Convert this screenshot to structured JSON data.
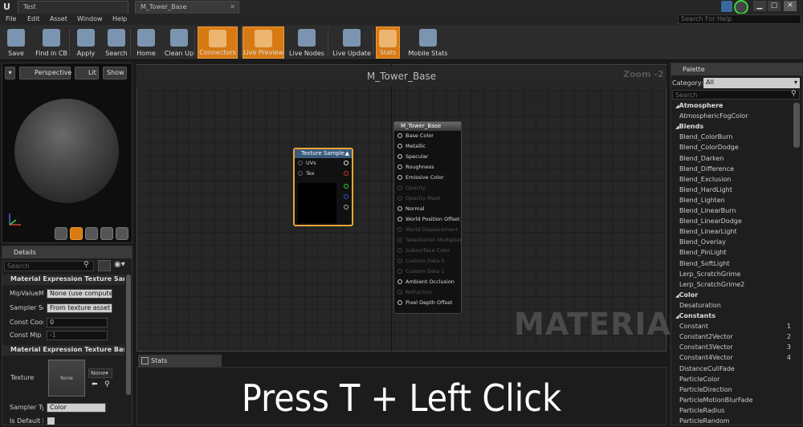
{
  "window": {
    "tabs": [
      "Test",
      "M_Tower_Base"
    ],
    "help_search_placeholder": "Search For Help"
  },
  "menu": [
    "File",
    "Edit",
    "Asset",
    "Window",
    "Help"
  ],
  "toolbar": [
    {
      "label": "Save",
      "icon": "save-icon",
      "active": false
    },
    {
      "label": "Find in CB",
      "icon": "find-icon",
      "active": false
    },
    {
      "label": "Apply",
      "icon": "apply-icon",
      "active": false
    },
    {
      "label": "Search",
      "icon": "binoculars-icon",
      "active": false
    },
    {
      "label": "Home",
      "icon": "home-icon",
      "active": false
    },
    {
      "label": "Clean Up",
      "icon": "broom-icon",
      "active": false
    },
    {
      "label": "Connectors",
      "icon": "connectors-icon",
      "active": true
    },
    {
      "label": "Live Preview",
      "icon": "live-preview-icon",
      "active": true
    },
    {
      "label": "Live Nodes",
      "icon": "live-nodes-icon",
      "active": false
    },
    {
      "label": "Live Update",
      "icon": "live-update-icon",
      "active": false
    },
    {
      "label": "Stats",
      "icon": "stats-icon",
      "active": true
    },
    {
      "label": "Mobile Stats",
      "icon": "mobile-stats-icon",
      "active": false
    }
  ],
  "viewport": {
    "buttons": [
      "Perspective",
      "Lit",
      "Show"
    ]
  },
  "details": {
    "tab": "Details",
    "search_placeholder": "Search",
    "section1": "Material Expression Texture Sample",
    "section2": "Material Expression Texture Base",
    "props": [
      {
        "label": "MipValueMode",
        "value": "None (use computed mip level)"
      },
      {
        "label": "Sampler Source",
        "value": "From texture asset"
      },
      {
        "label": "Const Coordinate",
        "value": "0"
      },
      {
        "label": "Const Mip Value",
        "value": "-1"
      }
    ],
    "texture_label": "Texture",
    "texture_value": "None",
    "texture_combo": "None",
    "sampler_type_label": "Sampler Type",
    "sampler_type_value": "Color",
    "is_default_label": "Is Default Meshpaint Texture"
  },
  "graph": {
    "title": "M_Tower_Base",
    "zoom": "Zoom -2",
    "watermark": "MATERIAL",
    "texture_node": {
      "title": "Texture Sample",
      "inputs": [
        "UVs",
        "Tex"
      ]
    },
    "material_node": {
      "title": "M_Tower_Base",
      "pins": [
        {
          "label": "Base Color",
          "enabled": true
        },
        {
          "label": "Metallic",
          "enabled": true
        },
        {
          "label": "Specular",
          "enabled": true
        },
        {
          "label": "Roughness",
          "enabled": true
        },
        {
          "label": "Emissive Color",
          "enabled": true
        },
        {
          "label": "Opacity",
          "enabled": false
        },
        {
          "label": "Opacity Mask",
          "enabled": false
        },
        {
          "label": "Normal",
          "enabled": true
        },
        {
          "label": "World Position Offset",
          "enabled": true
        },
        {
          "label": "World Displacement",
          "enabled": false
        },
        {
          "label": "Tessellation Multiplier",
          "enabled": false
        },
        {
          "label": "Subsurface Color",
          "enabled": false
        },
        {
          "label": "Custom Data 0",
          "enabled": false
        },
        {
          "label": "Custom Data 1",
          "enabled": false
        },
        {
          "label": "Ambient Occlusion",
          "enabled": true
        },
        {
          "label": "Refraction",
          "enabled": false
        },
        {
          "label": "Pixel Depth Offset",
          "enabled": true
        }
      ]
    }
  },
  "palette": {
    "tab": "Palette",
    "category_label": "Category:",
    "category_value": "All",
    "search_placeholder": "Search",
    "items": [
      {
        "label": "Atmosphere",
        "type": "cat"
      },
      {
        "label": "AtmosphericFogColor",
        "type": "item"
      },
      {
        "label": "Blends",
        "type": "cat"
      },
      {
        "label": "Blend_ColorBurn",
        "type": "item"
      },
      {
        "label": "Blend_ColorDodge",
        "type": "item"
      },
      {
        "label": "Blend_Darken",
        "type": "item"
      },
      {
        "label": "Blend_Difference",
        "type": "item"
      },
      {
        "label": "Blend_Exclusion",
        "type": "item"
      },
      {
        "label": "Blend_HardLight",
        "type": "item"
      },
      {
        "label": "Blend_Lighten",
        "type": "item"
      },
      {
        "label": "Blend_LinearBurn",
        "type": "item"
      },
      {
        "label": "Blend_LinearDodge",
        "type": "item"
      },
      {
        "label": "Blend_LinearLight",
        "type": "item"
      },
      {
        "label": "Blend_Overlay",
        "type": "item"
      },
      {
        "label": "Blend_PinLight",
        "type": "item"
      },
      {
        "label": "Blend_SoftLight",
        "type": "item"
      },
      {
        "label": "Lerp_ScratchGrime",
        "type": "item"
      },
      {
        "label": "Lerp_ScratchGrime2",
        "type": "item"
      },
      {
        "label": "Color",
        "type": "cat"
      },
      {
        "label": "Desaturation",
        "type": "item"
      },
      {
        "label": "Constants",
        "type": "cat"
      },
      {
        "label": "Constant",
        "type": "item",
        "hotkey": "1"
      },
      {
        "label": "Constant2Vector",
        "type": "item",
        "hotkey": "2"
      },
      {
        "label": "Constant3Vector",
        "type": "item",
        "hotkey": "3"
      },
      {
        "label": "Constant4Vector",
        "type": "item",
        "hotkey": "4"
      },
      {
        "label": "DistanceCullFade",
        "type": "item"
      },
      {
        "label": "ParticleColor",
        "type": "item"
      },
      {
        "label": "ParticleDirection",
        "type": "item"
      },
      {
        "label": "ParticleMotionBlurFade",
        "type": "item"
      },
      {
        "label": "ParticleRadius",
        "type": "item"
      },
      {
        "label": "ParticleRandom",
        "type": "item"
      }
    ]
  },
  "stats": {
    "tab": "Stats"
  },
  "caption": "Press T + Left Click",
  "colors": {
    "accent": "#d87a14",
    "node_header": "#3a5a7a",
    "node_border": "#e8a33a"
  }
}
